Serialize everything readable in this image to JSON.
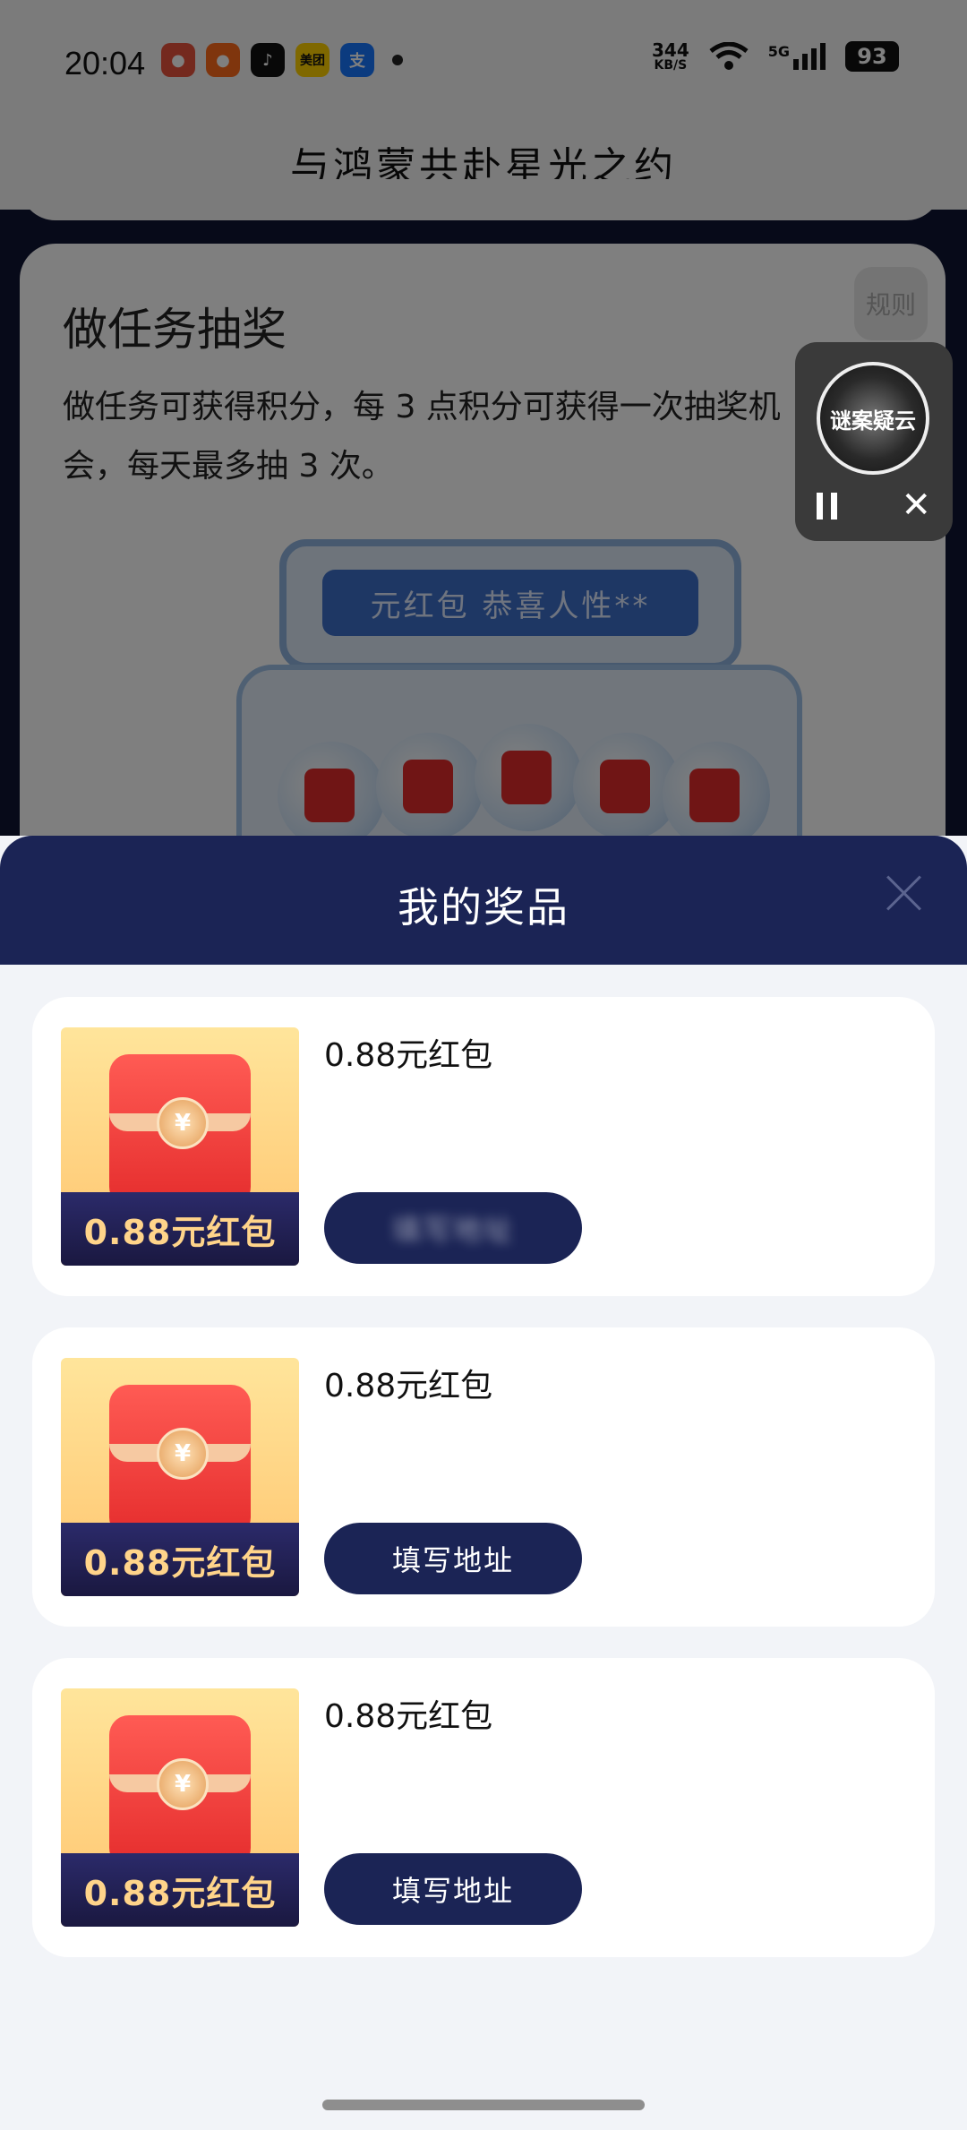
{
  "status_bar": {
    "time": "20:04",
    "net_speed_value": "344",
    "net_speed_unit": "KB/S",
    "signal_label": "5G",
    "battery": "93",
    "app_icons": [
      "app-shopping-icon",
      "app-taobao-icon",
      "tiktok-icon",
      "meituan-icon",
      "alipay-icon"
    ],
    "meituan_label": "美团",
    "alipay_label": "支"
  },
  "page": {
    "title": "与鸿蒙共赴星光之约",
    "task_title": "做任务抽奖",
    "task_desc": "做任务可获得积分，每 3 点积分可获得一次抽奖机会，每天最多抽 3 次。",
    "rules_label": "规则",
    "machine_screen": "元红包  恭喜人性**"
  },
  "audio_widget": {
    "disc_text": "谜案疑云"
  },
  "sheet": {
    "title": "我的奖品",
    "prizes": [
      {
        "image_label": "0.88元红包",
        "name": "0.88元红包",
        "button": "填写地址"
      },
      {
        "image_label": "0.88元红包",
        "name": "0.88元红包",
        "button": "填写地址"
      },
      {
        "image_label": "0.88元红包",
        "name": "0.88元红包",
        "button": "填写地址"
      }
    ]
  },
  "colors": {
    "sheet_header": "#1b2455",
    "button": "#1b2455",
    "prize_text": "#ffd48a"
  }
}
